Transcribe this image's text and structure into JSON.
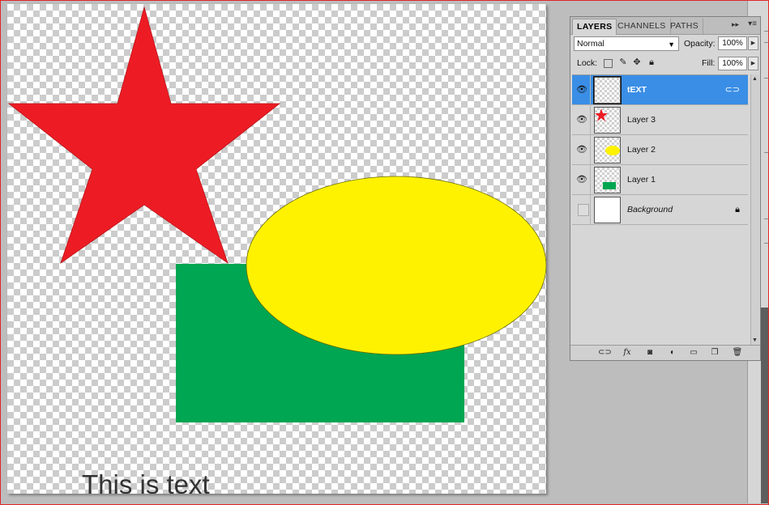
{
  "canvas": {
    "text_layer_content": "This is text",
    "colors": {
      "star": "#ed1c24",
      "rectangle": "#00a651",
      "ellipse": "#fff200"
    }
  },
  "layers_panel": {
    "tabs": [
      {
        "label": "LAYERS",
        "active": true
      },
      {
        "label": "CHANNELS",
        "active": false
      },
      {
        "label": "PATHS",
        "active": false
      }
    ],
    "blend_mode": "Normal",
    "opacity_label": "Opacity:",
    "opacity_value": "100%",
    "lock_label": "Lock:",
    "fill_label": "Fill:",
    "fill_value": "100%",
    "layers": [
      {
        "name": "tEXT",
        "visible": true,
        "selected": true,
        "icon": "link-icon"
      },
      {
        "name": "Layer 3",
        "visible": true,
        "selected": false,
        "thumbnail": "star"
      },
      {
        "name": "Layer 2",
        "visible": true,
        "selected": false,
        "thumbnail": "ellipse"
      },
      {
        "name": "Layer 1",
        "visible": true,
        "selected": false,
        "thumbnail": "rectangle"
      },
      {
        "name": "Background",
        "visible": false,
        "selected": false,
        "icon": "lock-icon"
      }
    ],
    "footer_icons": [
      "link-layers-icon",
      "fx-icon",
      "mask-icon",
      "adjustment-icon",
      "group-icon",
      "new-layer-icon",
      "trash-icon"
    ],
    "selected_color": "#3a8ee6"
  }
}
